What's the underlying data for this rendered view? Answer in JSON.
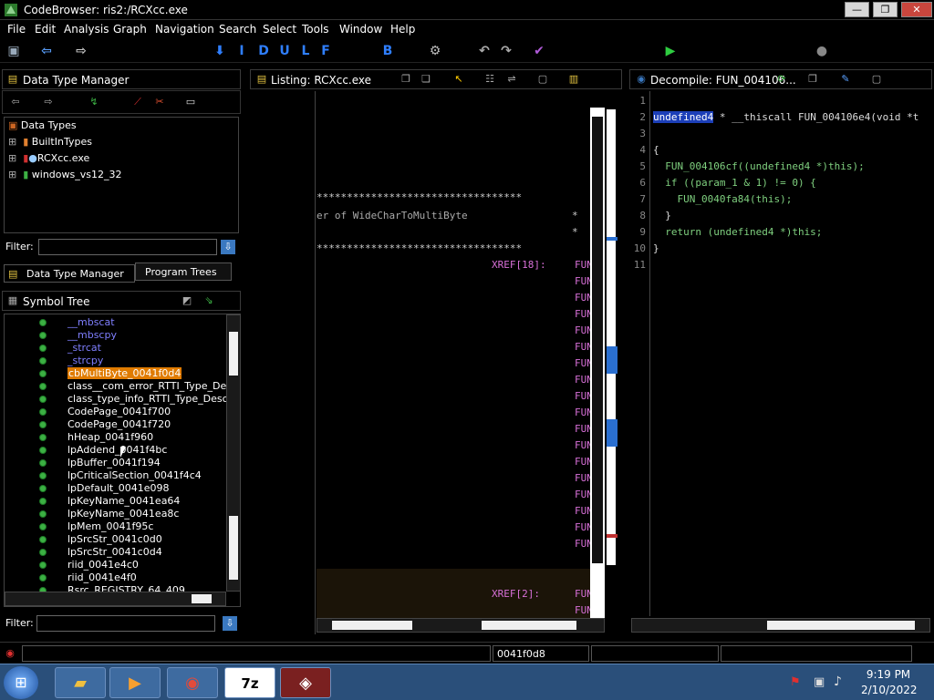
{
  "window": {
    "title": "CodeBrowser: ris2:/RCXcc.exe",
    "minimize": "—",
    "maximize": "❐",
    "close": "✕"
  },
  "menu": [
    "File",
    "Edit",
    "Analysis",
    "Graph",
    "Navigation",
    "Search",
    "Select",
    "Tools",
    "Window",
    "Help"
  ],
  "toolbar_letters": [
    "I",
    "D",
    "U",
    "L",
    "F",
    "B"
  ],
  "data_type_manager": {
    "title": "Data Type Manager",
    "root": "Data Types",
    "items": [
      "BuiltInTypes",
      "RCXcc.exe",
      "windows_vs12_32"
    ],
    "filter_label": "Filter:",
    "filter_value": "",
    "tabs": [
      "Data Type Manager",
      "Program Trees"
    ]
  },
  "symbol_tree": {
    "title": "Symbol Tree",
    "items": [
      {
        "label": "__mbscat",
        "kind": "func"
      },
      {
        "label": "__mbscpy",
        "kind": "func"
      },
      {
        "label": "_strcat",
        "kind": "func"
      },
      {
        "label": "_strcpy",
        "kind": "func"
      },
      {
        "label": "cbMultiByte_0041f0d4",
        "kind": "selected"
      },
      {
        "label": "class__com_error_RTTI_Type_Descri",
        "kind": "label"
      },
      {
        "label": "class_type_info_RTTI_Type_Descript",
        "kind": "label"
      },
      {
        "label": "CodePage_0041f700",
        "kind": "label"
      },
      {
        "label": "CodePage_0041f720",
        "kind": "label"
      },
      {
        "label": "hHeap_0041f960",
        "kind": "label"
      },
      {
        "label": "lpAddend_0041f4bc",
        "kind": "label"
      },
      {
        "label": "lpBuffer_0041f194",
        "kind": "label"
      },
      {
        "label": "lpCriticalSection_0041f4c4",
        "kind": "label"
      },
      {
        "label": "lpDefault_0041e098",
        "kind": "label"
      },
      {
        "label": "lpKeyName_0041ea64",
        "kind": "label"
      },
      {
        "label": "lpKeyName_0041ea8c",
        "kind": "label"
      },
      {
        "label": "lpMem_0041f95c",
        "kind": "label"
      },
      {
        "label": "lpSrcStr_0041c0d0",
        "kind": "label"
      },
      {
        "label": "lpSrcStr_0041c0d4",
        "kind": "label"
      },
      {
        "label": "riid_0041e4c0",
        "kind": "label"
      },
      {
        "label": "riid_0041e4f0",
        "kind": "label"
      },
      {
        "label": "Rsrc_REGISTRY_64_409",
        "kind": "label"
      }
    ],
    "filter_label": "Filter:",
    "filter_value": ""
  },
  "listing": {
    "title": "Listing:  RCXcc.exe",
    "stars_line": "**********************************",
    "comment_line": "er of WideCharToMultiByte",
    "star_end": "*",
    "xref1": "XREF[18]:",
    "xref2": "XREF[2]:",
    "fun_prefix": "FUN"
  },
  "decompile": {
    "title": "Decompile: FUN_004106...",
    "line_numbers": [
      "1",
      "2",
      "3",
      "4",
      "5",
      "6",
      "7",
      "8",
      "9",
      "10",
      "11"
    ],
    "code": {
      "l2_type": "undefined4",
      "l2_rest": " * __thiscall FUN_004106e4(void *t",
      "l4": "{",
      "l5": "  FUN_004106cf((undefined4 *)this);",
      "l6": "  if ((param_1 & 1) != 0) {",
      "l7": "    FUN_0040fa84(this);",
      "l8": "  }",
      "l9": "  return (undefined4 *)this;",
      "l10": "}"
    }
  },
  "status": {
    "address": "0041f0d8"
  },
  "taskbar": {
    "time": "9:19 PM",
    "date": "2/10/2022",
    "sevenzip": "7z"
  },
  "colors": {
    "accent_selected": "#e07b00",
    "func_blue": "#7f7fff",
    "xref_pink": "#d870d8",
    "code_green": "#7fd07f"
  }
}
